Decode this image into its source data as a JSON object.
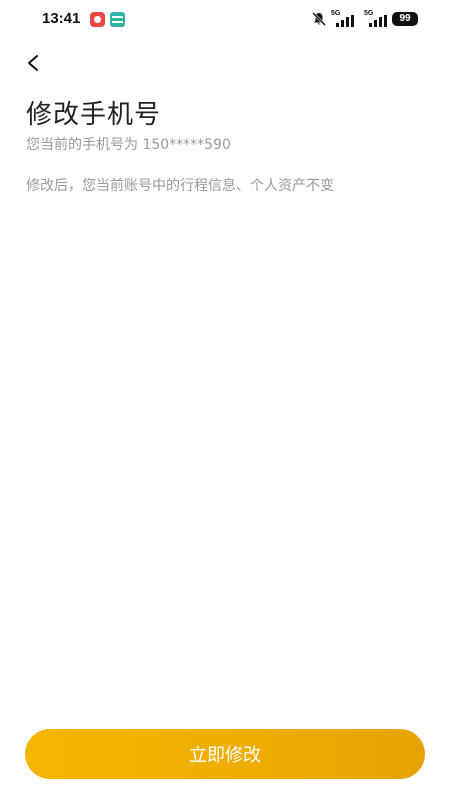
{
  "status_bar": {
    "time": "13:41",
    "app_icons": [
      "notification-app-icon",
      "news-app-icon"
    ],
    "signal_1_label": "5G",
    "signal_2_label": "5G",
    "battery": "99"
  },
  "header": {
    "back_icon": "chevron-left-icon"
  },
  "main": {
    "title": "修改手机号",
    "current_phone": "您当前的手机号为 150*****590",
    "hint": "修改后，您当前账号中的行程信息、个人资产不变"
  },
  "footer": {
    "confirm_label": "立即修改",
    "button_color": "#F2AE02"
  }
}
